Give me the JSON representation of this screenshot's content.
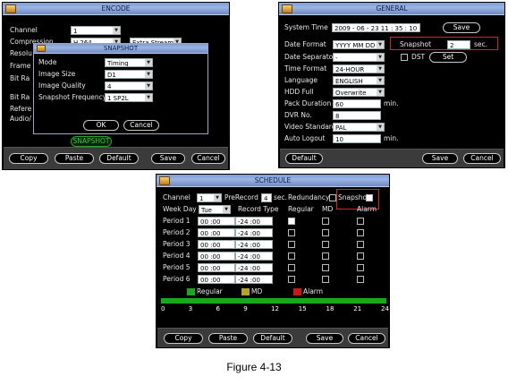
{
  "encode": {
    "title": "ENCODE",
    "labels": {
      "channel": "Channel",
      "compression": "Compression",
      "resolution": "Resolu",
      "frame": "Frame",
      "bitrate1": "Bit Ra",
      "bitrate2": "Bit Ra",
      "reference": "Refere",
      "audio": "Audio/"
    },
    "channel_value": "1",
    "compression_value": "H.264",
    "stream_value": "Extra Stream1",
    "snapshot_button": "SNAPSHOT",
    "buttons": {
      "copy": "Copy",
      "paste": "Paste",
      "default": "Default",
      "save": "Save",
      "cancel": "Cancel"
    },
    "dialog": {
      "title": "SNAPSHOT",
      "labels": {
        "mode": "Mode",
        "image_size": "Image Size",
        "image_quality": "Image Quality",
        "frequency": "Snapshot Frequency"
      },
      "values": {
        "mode": "Timing",
        "image_size": "D1",
        "image_quality": "4",
        "frequency": "1 SP2L"
      },
      "ok": "OK",
      "cancel": "Cancel"
    }
  },
  "general": {
    "title": "GENERAL",
    "labels": {
      "system_time": "System Time",
      "date_format": "Date Format",
      "date_separator": "Date Separator",
      "time_format": "Time Format",
      "language": "Language",
      "hdd_full": "HDD Full",
      "pack_duration": "Pack Duration",
      "dvr_no": "DVR No.",
      "video_standard": "Video Standard",
      "auto_logout": "Auto Logout",
      "snapshot": "Snapshot",
      "sec": "sec.",
      "dst": "DST",
      "min1": "min.",
      "min2": "min."
    },
    "values": {
      "system_time": "2009 - 06 - 23  11 : 35 : 10",
      "date_format": "YYYY MM DD",
      "date_separator": "-",
      "time_format": "24-HOUR",
      "language": "ENGLISH",
      "hdd_full": "Overwrite",
      "pack_duration": "60",
      "dvr_no": "8",
      "video_standard": "PAL",
      "auto_logout": "10",
      "snapshot": "2"
    },
    "buttons": {
      "save_top": "Save",
      "set": "Set",
      "default": "Default",
      "save": "Save",
      "cancel": "Cancel"
    }
  },
  "schedule": {
    "title": "SCHEDULE",
    "labels": {
      "channel": "Channel",
      "prerecord": "PreRecord",
      "sec": "sec.",
      "redundancy": "Redundancy",
      "snapshot": "Snapshot",
      "week_day": "Week Day",
      "record_type": "Record Type",
      "regular": "Regular",
      "md": "MD",
      "alarm": "Alarm"
    },
    "channel_value": "1",
    "prerecord_value": "4",
    "week_day_value": "Tue",
    "periods": [
      {
        "label": "Period 1",
        "start": "00 :00",
        "end": "-24 :00"
      },
      {
        "label": "Period 2",
        "start": "00 :00",
        "end": "-24 :00"
      },
      {
        "label": "Period 3",
        "start": "00 :00",
        "end": "-24 :00"
      },
      {
        "label": "Period 4",
        "start": "00 :00",
        "end": "-24 :00"
      },
      {
        "label": "Period 5",
        "start": "00 :00",
        "end": "-24 :00"
      },
      {
        "label": "Period 6",
        "start": "00 :00",
        "end": "-24 :00"
      }
    ],
    "legend": {
      "regular": "Regular",
      "md": "MD",
      "alarm": "Alarm"
    },
    "hours": [
      "0",
      "3",
      "6",
      "9",
      "12",
      "15",
      "18",
      "21",
      "24"
    ],
    "buttons": {
      "copy": "Copy",
      "paste": "Paste",
      "default": "Default",
      "save": "Save",
      "cancel": "Cancel"
    }
  },
  "caption": "Figure 4-13",
  "colors": {
    "regular": "#17a81d",
    "md": "#b8a020",
    "alarm": "#c81818",
    "highlight": "#e02020"
  }
}
